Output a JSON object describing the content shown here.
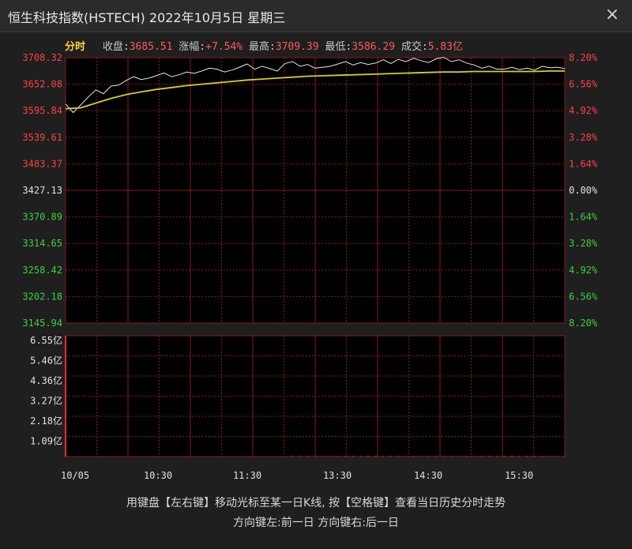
{
  "window": {
    "title": "恒生科技指数(HSTECH) 2022年10月5日 星期三",
    "close_glyph": "×"
  },
  "info": {
    "mode": "分时",
    "close_label": "收盘:",
    "close_value": "3685.51",
    "change_label": "涨幅:",
    "change_value": "+7.54%",
    "high_label": "最高:",
    "high_value": "3709.39",
    "low_label": "最低:",
    "low_value": "3586.29",
    "volume_label": "成交:",
    "volume_value": "5.83亿"
  },
  "colors": {
    "up": "#ff4040",
    "down": "#3cd03c",
    "neutral": "#e0e0e0",
    "grid": "#8b1a1a",
    "price_line": "#e6e6e6",
    "avg_line": "#d8d020",
    "volume": "#e03030"
  },
  "chart_data": [
    {
      "type": "line",
      "y_labels_left": [
        "3708.32",
        "3652.08",
        "3595.84",
        "3539.61",
        "3483.37",
        "3427.13",
        "3370.89",
        "3314.65",
        "3258.42",
        "3202.18",
        "3145.94"
      ],
      "y_labels_right": [
        "8.20%",
        "6.56%",
        "4.92%",
        "3.28%",
        "1.64%",
        "0.00%",
        "1.64%",
        "3.28%",
        "4.92%",
        "6.56%",
        "8.20%"
      ],
      "x_labels": [
        "10/05",
        "10:30",
        "11:30",
        "13:30",
        "14:30",
        "15:30"
      ],
      "ylim": [
        3145.94,
        3708.32
      ],
      "prev_close": 3427.13,
      "grid": true,
      "series": [
        {
          "style": "price",
          "x": [
            0,
            5,
            10,
            15,
            20,
            25,
            30,
            35,
            40,
            45,
            50,
            55,
            60,
            65,
            70,
            75,
            80,
            85,
            90,
            95,
            100,
            105,
            110,
            115,
            120,
            125,
            130,
            135,
            140,
            145,
            150,
            155,
            160,
            165,
            170,
            175,
            180,
            185,
            190,
            195,
            200,
            205,
            210,
            215,
            220,
            225,
            230,
            235,
            240,
            245,
            250,
            255,
            260,
            265,
            270,
            275,
            280,
            285,
            290,
            295,
            300,
            305,
            310,
            315,
            320,
            325,
            330
          ],
          "values": [
            3610,
            3592,
            3608,
            3625,
            3640,
            3632,
            3648,
            3650,
            3660,
            3668,
            3662,
            3665,
            3670,
            3676,
            3668,
            3672,
            3678,
            3675,
            3680,
            3686,
            3684,
            3678,
            3682,
            3688,
            3695,
            3684,
            3690,
            3685,
            3680,
            3696,
            3700,
            3690,
            3694,
            3686,
            3688,
            3690,
            3695,
            3700,
            3693,
            3698,
            3694,
            3697,
            3704,
            3696,
            3705,
            3700,
            3707,
            3702,
            3698,
            3706,
            3709,
            3700,
            3704,
            3697,
            3693,
            3686,
            3690,
            3684,
            3684,
            3688,
            3683,
            3686,
            3682,
            3690,
            3687,
            3688,
            3685
          ]
        },
        {
          "style": "average",
          "x": [
            0,
            10,
            20,
            30,
            40,
            50,
            60,
            70,
            80,
            90,
            100,
            110,
            120,
            130,
            140,
            150,
            160,
            170,
            180,
            190,
            200,
            210,
            220,
            230,
            240,
            250,
            260,
            270,
            280,
            290,
            300,
            310,
            320,
            330
          ],
          "values": [
            3600,
            3602,
            3612,
            3622,
            3630,
            3636,
            3641,
            3645,
            3649,
            3652,
            3655,
            3658,
            3661,
            3663,
            3665,
            3667,
            3669,
            3670,
            3671,
            3672,
            3673,
            3674,
            3675,
            3676,
            3677,
            3678,
            3678,
            3679,
            3679,
            3679,
            3679,
            3679,
            3680,
            3680
          ]
        }
      ]
    },
    {
      "type": "bar",
      "y_labels": [
        "6.55亿",
        "5.46亿",
        "4.36亿",
        "3.27亿",
        "2.18亿",
        "1.09亿"
      ],
      "ylim": [
        0,
        6.55
      ],
      "x": [
        0,
        150,
        155,
        160,
        165,
        170,
        175,
        180,
        185,
        190,
        195,
        200,
        205,
        210,
        215,
        220,
        225,
        230,
        235,
        240,
        245,
        250,
        255,
        260,
        265,
        270,
        275,
        280,
        285,
        290,
        295,
        300,
        305,
        310,
        315,
        320,
        325,
        330
      ],
      "values": [
        6.55,
        0.05,
        0.05,
        0.05,
        0.05,
        0.05,
        0.05,
        0.05,
        0.05,
        0.05,
        0.05,
        0.05,
        0.05,
        0.05,
        0.05,
        0.05,
        0.05,
        0.05,
        0.05,
        0.05,
        0.05,
        0.05,
        0.05,
        0.05,
        0.05,
        0.05,
        0.05,
        0.05,
        0.05,
        0.05,
        0.05,
        0.05,
        0.05,
        0.05,
        0.05,
        0.05,
        0.05,
        0.05
      ]
    }
  ],
  "footer": {
    "line1": "用键盘【左右键】移动光标至某一日K线, 按【空格键】查看当日历史分时走势",
    "line2": "方向键左:前一日    方向键右:后一日"
  }
}
